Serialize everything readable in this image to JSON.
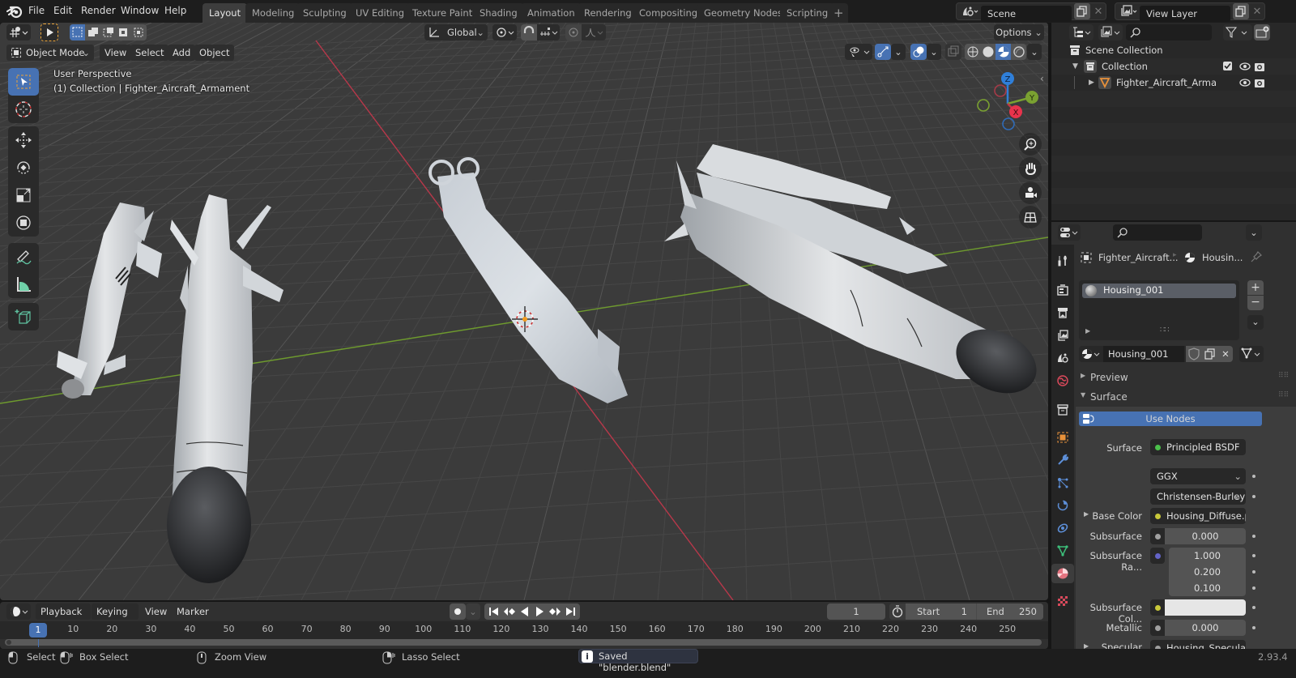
{
  "app": {
    "name": "Blender",
    "version": "2.93.4"
  },
  "menu": {
    "items": [
      "File",
      "Edit",
      "Render",
      "Window",
      "Help"
    ]
  },
  "workspaces": {
    "tabs": [
      "Layout",
      "Modeling",
      "Sculpting",
      "UV Editing",
      "Texture Paint",
      "Shading",
      "Animation",
      "Rendering",
      "Compositing",
      "Geometry Nodes",
      "Scripting"
    ],
    "active": "Layout",
    "add_label": "+"
  },
  "scene": {
    "name": "Scene",
    "view_layer": "View Layer"
  },
  "viewport": {
    "mode": "Object Mode",
    "menus": [
      "View",
      "Select",
      "Add",
      "Object"
    ],
    "transform_orientation": "Global",
    "options_label": "Options",
    "perspective_label": "User Perspective",
    "collection_label": "(1) Collection | Fighter_Aircraft_Armament",
    "shading_active": "solid-material-preview",
    "gizmo_axes": {
      "x": "X",
      "y": "Y",
      "z": "Z"
    },
    "colors": {
      "x_axis": "#c1374a",
      "y_axis": "#7aa131",
      "z_axis": "#2f7fd9",
      "grid": "#4a4a4a",
      "background": "#3b3b3b"
    }
  },
  "outliner": {
    "search_placeholder": "",
    "rows": [
      {
        "label": "Scene Collection",
        "type": "scene-collection"
      },
      {
        "label": "Collection",
        "type": "collection",
        "expanded": true,
        "checked": true
      },
      {
        "label": "Fighter_Aircraft_Armame",
        "type": "object",
        "expanded": false
      }
    ]
  },
  "properties": {
    "search_placeholder": "",
    "breadcrumb": {
      "object": "Fighter_Aircraft...",
      "material": "Housin..."
    },
    "material_slots": [
      "Housing_001"
    ],
    "material_name": "Housing_001",
    "panels": {
      "preview": "Preview",
      "surface": "Surface"
    },
    "use_nodes_label": "Use Nodes",
    "fields": [
      {
        "label": "Surface",
        "value": "Principled BSDF",
        "dot": "#4bc04b"
      },
      {
        "label": "",
        "value": "GGX",
        "dropdown": true
      },
      {
        "label": "",
        "value": "Christensen-Burley",
        "dropdown": true
      },
      {
        "label": "Base Color",
        "value": "Housing_Diffuse.png",
        "dot": "#c8c83a"
      },
      {
        "label": "Subsurface",
        "value": "0.000",
        "dot": "#a0a0a0"
      },
      {
        "label": "Subsurface Ra...",
        "values": [
          "1.000",
          "0.200",
          "0.100"
        ],
        "dot": "#6363c7"
      },
      {
        "label": "Subsurface Col...",
        "value": "",
        "dot": "#c8c83a",
        "swatch": "#e6e6e6"
      },
      {
        "label": "Metallic",
        "value": "0.000",
        "dot": "#a0a0a0"
      },
      {
        "label": "Specular",
        "value": "Housing_Specular",
        "dot": "#a0a0a0"
      }
    ],
    "accent": "#4772b3"
  },
  "timeline": {
    "menus": [
      "Playback",
      "Keying",
      "View",
      "Marker"
    ],
    "current_frame": "1",
    "start_label": "Start",
    "start": "1",
    "end_label": "End",
    "end": "250",
    "ticks": [
      "10",
      "20",
      "30",
      "40",
      "50",
      "60",
      "70",
      "80",
      "90",
      "100",
      "110",
      "120",
      "130",
      "140",
      "150",
      "160",
      "170",
      "180",
      "190",
      "200",
      "210",
      "220",
      "230",
      "240",
      "250"
    ]
  },
  "status": {
    "select": "Select",
    "box_select": "Box Select",
    "zoom_view": "Zoom View",
    "lasso_select": "Lasso Select",
    "message": "Saved \"blender.blend\"",
    "version": "2.93.4"
  }
}
